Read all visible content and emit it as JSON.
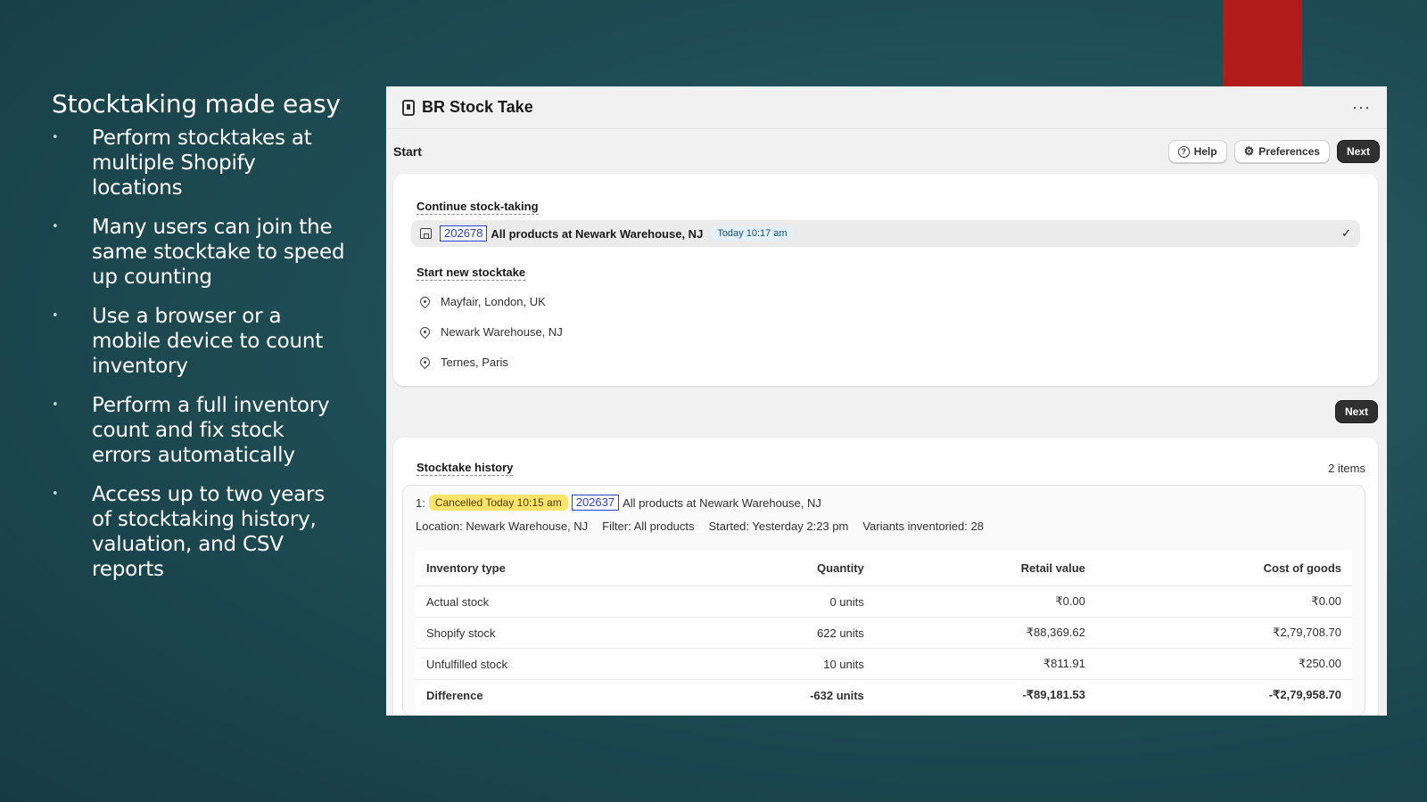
{
  "slide": {
    "title": "Stocktaking made easy",
    "bullets": [
      "Perform stocktakes at multiple Shopify locations",
      "Many users can join the same stocktake to speed up counting",
      "Use a browser or a mobile device to count inventory",
      "Perform a full inventory count and fix stock errors automatically",
      "Access up to two years of stocktaking history, valuation, and CSV reports"
    ]
  },
  "app": {
    "title": "BR Stock Take",
    "more_label": "···"
  },
  "toolbar": {
    "title": "Start",
    "help_label": "Help",
    "preferences_label": "Preferences",
    "next_label": "Next"
  },
  "continue_section": {
    "label": "Continue stock-taking",
    "stocktake_id": "202678",
    "description": "All products at Newark Warehouse, NJ",
    "time": "Today 10:17 am"
  },
  "new_section": {
    "label": "Start new stocktake",
    "locations": [
      "Mayfair, London, UK",
      "Newark Warehouse, NJ",
      "Ternes, Paris"
    ]
  },
  "next_button_label": "Next",
  "history": {
    "label": "Stocktake history",
    "count": "2 items",
    "item": {
      "index": "1:",
      "status": "Cancelled Today 10:15 am",
      "stocktake_id": "202637",
      "description": "All products at Newark Warehouse, NJ",
      "location": "Location: Newark Warehouse, NJ",
      "filter": "Filter: All products",
      "started": "Started: Yesterday 2:23 pm",
      "variants": "Variants inventoried: 28",
      "table": {
        "headers": [
          "Inventory type",
          "Quantity",
          "Retail value",
          "Cost of goods"
        ],
        "rows": [
          [
            "Actual stock",
            "0 units",
            "₹0.00",
            "₹0.00"
          ],
          [
            "Shopify stock",
            "622 units",
            "₹88,369.62",
            "₹2,79,708.70"
          ],
          [
            "Unfulfilled stock",
            "10 units",
            "₹811.91",
            "₹250.00"
          ],
          [
            "Difference",
            "-632 units",
            "-₹89,181.53",
            "-₹2,79,958.70"
          ]
        ]
      }
    }
  },
  "colors": {
    "accent_red": "#b31a1a",
    "primary_button": "#303030",
    "id_link": "#2b3fd4",
    "cancel_badge": "#ffe46b"
  }
}
